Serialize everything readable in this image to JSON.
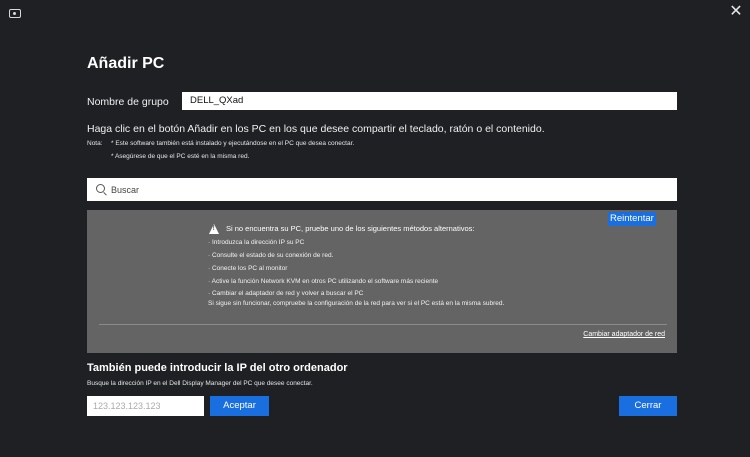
{
  "window": {
    "close_glyph": "✕"
  },
  "title": "Añadir PC",
  "group": {
    "label": "Nombre de grupo",
    "value": "DELL_QXad"
  },
  "instruction": "Haga clic en el botón Añadir en los PC en los que desee compartir el teclado, ratón o el contenido.",
  "notes": {
    "label": "Nota:",
    "items": [
      "* Este software también está instalado y ejecutándose en el PC que desea conectar.",
      "* Asegúrese de que el PC esté en la misma red."
    ]
  },
  "search": {
    "placeholder": "Buscar"
  },
  "results": {
    "warning": "Si no encuentra su PC, pruebe uno de los siguientes métodos alternativos:",
    "retry_label": "Reintentar",
    "methods": [
      "· Introduzca la dirección IP su PC",
      "· Consulte el estado de su conexión de red.",
      "· Conecte los PC al monitor",
      "· Active la función Network KVM en otros PC utilizando el software más reciente",
      "· Cambiar el adaptador de red y volver a buscar el PC",
      "Si sigue sin funcionar, compruebe la configuración de la red para ver si el PC está en la misma subred."
    ],
    "change_adapter_label": "Cambiar adaptador de red"
  },
  "ip": {
    "title": "También puede introducir la IP del otro ordenador",
    "subtitle": "Busque la dirección IP en el Dell Display Manager del PC que desee conectar.",
    "placeholder": "123.123.123.123",
    "accept_label": "Aceptar"
  },
  "close_label": "Cerrar",
  "colors": {
    "background": "#1f2024",
    "accent": "#1a6fe0",
    "results_bg": "#646464"
  }
}
